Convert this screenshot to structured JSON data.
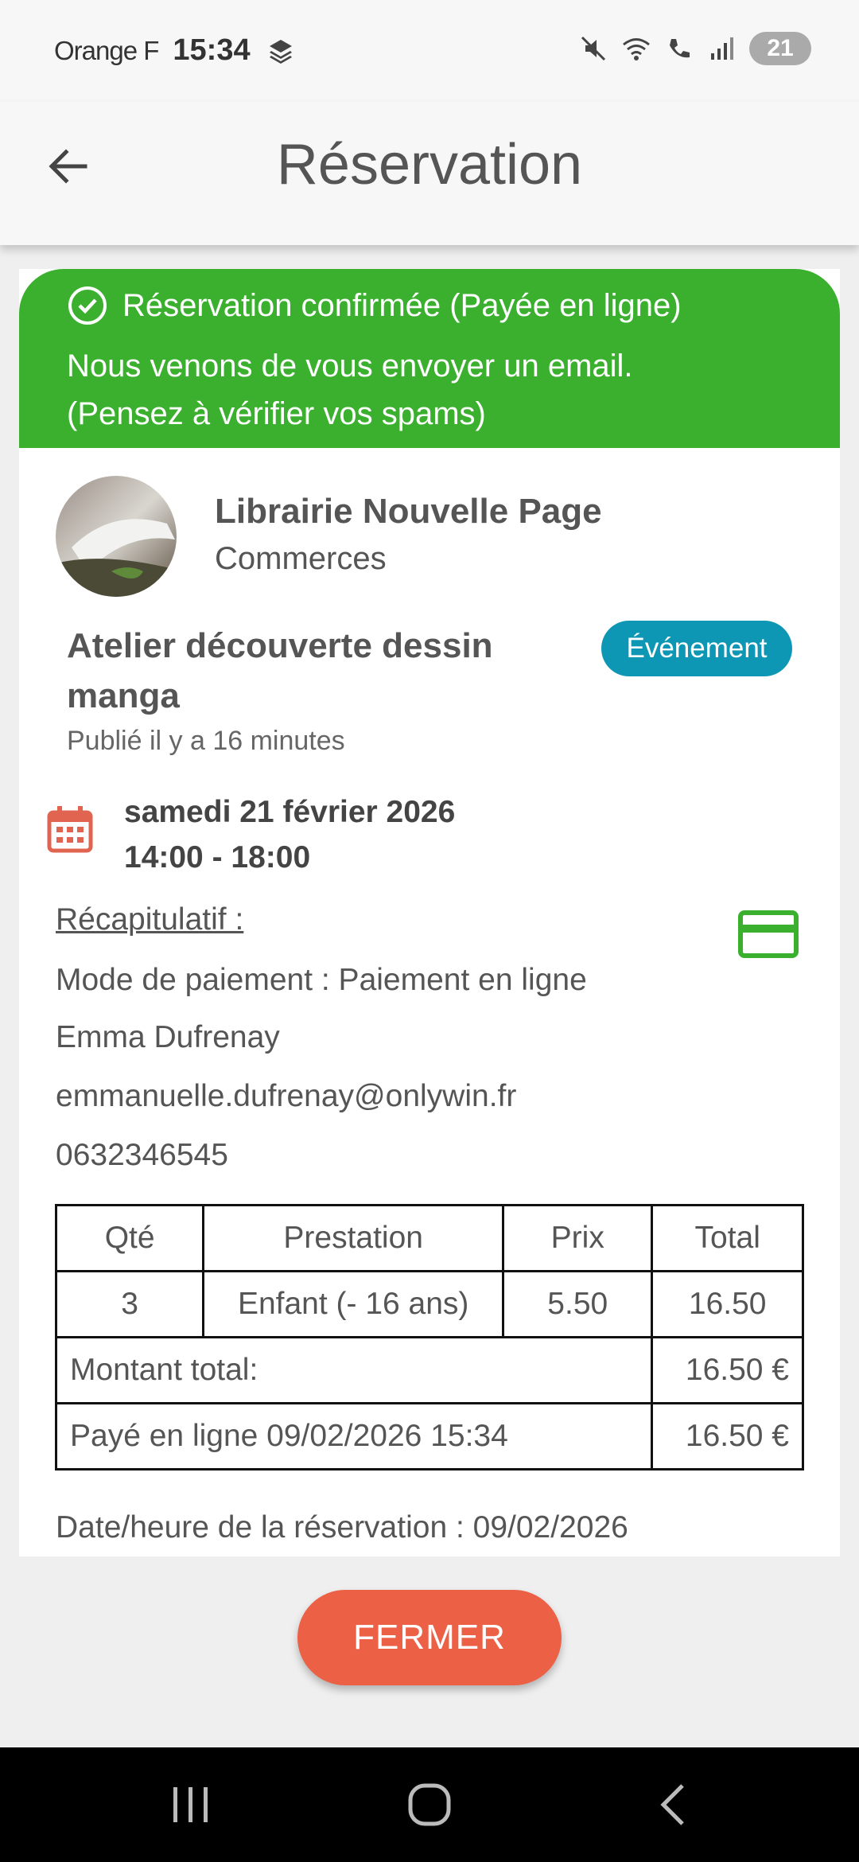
{
  "status_bar": {
    "carrier": "Orange F",
    "time": "15:34",
    "battery": "21"
  },
  "header": {
    "title": "Réservation",
    "back_icon": "arrow-left-icon"
  },
  "confirmation": {
    "title": "Réservation confirmée (Payée en ligne)",
    "message_line1": "Nous venons de vous envoyer un email.",
    "message_line2": "(Pensez à vérifier vos spams)",
    "color": "#3bb02f"
  },
  "merchant": {
    "name": "Librairie Nouvelle Page",
    "category": "Commerces"
  },
  "event": {
    "title_line1": "Atelier découverte dessin",
    "title_line2": "manga",
    "badge": "Événement",
    "badge_color": "#0e97b4",
    "published": "Publié il y a 16 minutes",
    "date": "samedi 21 février 2026",
    "time": "14:00 - 18:00"
  },
  "recap": {
    "title": "Récapitulatif :",
    "payment_mode": "Mode de paiement : Paiement en ligne",
    "name": "Emma Dufrenay",
    "email": "emmanuelle.dufrenay@onlywin.fr",
    "phone": "0632346545"
  },
  "order_table": {
    "headers": [
      "Qté",
      "Prestation",
      "Prix",
      "Total"
    ],
    "rows": [
      [
        "3",
        "Enfant (- 16 ans)",
        "5.50",
        "16.50"
      ]
    ],
    "total_label": "Montant total:",
    "total_value": "16.50 €",
    "paid_label": "Payé en ligne 09/02/2026 15:34",
    "paid_value": "16.50 €"
  },
  "booking_datetime": "Date/heure de la réservation : 09/02/2026",
  "close_button": {
    "label": "FERMER",
    "color": "#ec6046"
  }
}
